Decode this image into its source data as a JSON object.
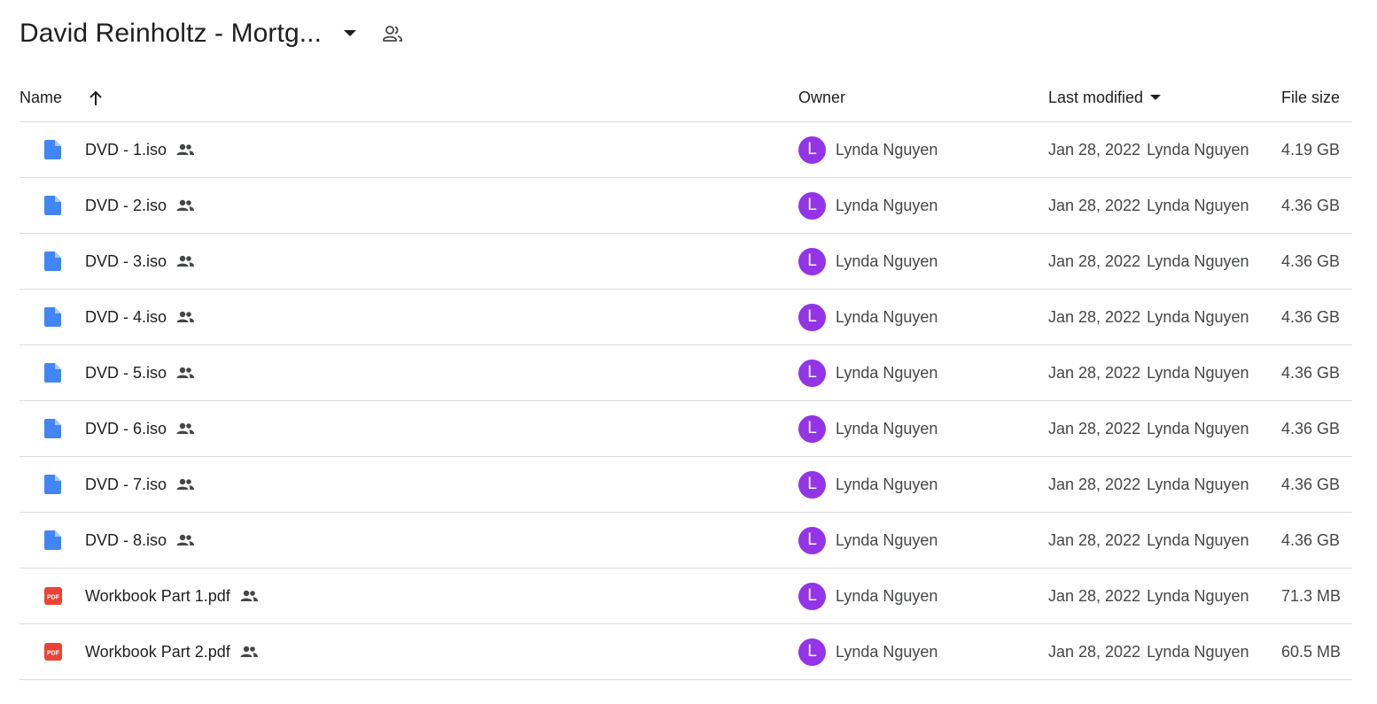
{
  "header": {
    "title": "David Reinholtz - Mortg...",
    "dropdown_icon": "caret-down-icon",
    "share_icon": "shared-folder-people-icon"
  },
  "columns": {
    "name": "Name",
    "sort_icon": "arrow-up-icon",
    "owner": "Owner",
    "last_modified": "Last modified",
    "last_modified_icon": "caret-down-icon",
    "file_size": "File size"
  },
  "colors": {
    "doc_icon": "#4285f4",
    "pdf_icon": "#ea4335",
    "avatar": "#9334e6",
    "divider": "#dadce0"
  },
  "files": [
    {
      "name": "DVD - 1.iso",
      "type": "file",
      "owner_initial": "L",
      "owner": "Lynda Nguyen",
      "modified_date": "Jan 28, 2022",
      "modified_by": "Lynda Nguyen",
      "size": "4.19 GB"
    },
    {
      "name": "DVD - 2.iso",
      "type": "file",
      "owner_initial": "L",
      "owner": "Lynda Nguyen",
      "modified_date": "Jan 28, 2022",
      "modified_by": "Lynda Nguyen",
      "size": "4.36 GB"
    },
    {
      "name": "DVD - 3.iso",
      "type": "file",
      "owner_initial": "L",
      "owner": "Lynda Nguyen",
      "modified_date": "Jan 28, 2022",
      "modified_by": "Lynda Nguyen",
      "size": "4.36 GB"
    },
    {
      "name": "DVD - 4.iso",
      "type": "file",
      "owner_initial": "L",
      "owner": "Lynda Nguyen",
      "modified_date": "Jan 28, 2022",
      "modified_by": "Lynda Nguyen",
      "size": "4.36 GB"
    },
    {
      "name": "DVD - 5.iso",
      "type": "file",
      "owner_initial": "L",
      "owner": "Lynda Nguyen",
      "modified_date": "Jan 28, 2022",
      "modified_by": "Lynda Nguyen",
      "size": "4.36 GB"
    },
    {
      "name": "DVD - 6.iso",
      "type": "file",
      "owner_initial": "L",
      "owner": "Lynda Nguyen",
      "modified_date": "Jan 28, 2022",
      "modified_by": "Lynda Nguyen",
      "size": "4.36 GB"
    },
    {
      "name": "DVD - 7.iso",
      "type": "file",
      "owner_initial": "L",
      "owner": "Lynda Nguyen",
      "modified_date": "Jan 28, 2022",
      "modified_by": "Lynda Nguyen",
      "size": "4.36 GB"
    },
    {
      "name": "DVD - 8.iso",
      "type": "file",
      "owner_initial": "L",
      "owner": "Lynda Nguyen",
      "modified_date": "Jan 28, 2022",
      "modified_by": "Lynda Nguyen",
      "size": "4.36 GB"
    },
    {
      "name": "Workbook Part 1.pdf",
      "type": "pdf",
      "owner_initial": "L",
      "owner": "Lynda Nguyen",
      "modified_date": "Jan 28, 2022",
      "modified_by": "Lynda Nguyen",
      "size": "71.3 MB"
    },
    {
      "name": "Workbook Part 2.pdf",
      "type": "pdf",
      "owner_initial": "L",
      "owner": "Lynda Nguyen",
      "modified_date": "Jan 28, 2022",
      "modified_by": "Lynda Nguyen",
      "size": "60.5 MB"
    }
  ],
  "pdf_badge_text": "PDF"
}
